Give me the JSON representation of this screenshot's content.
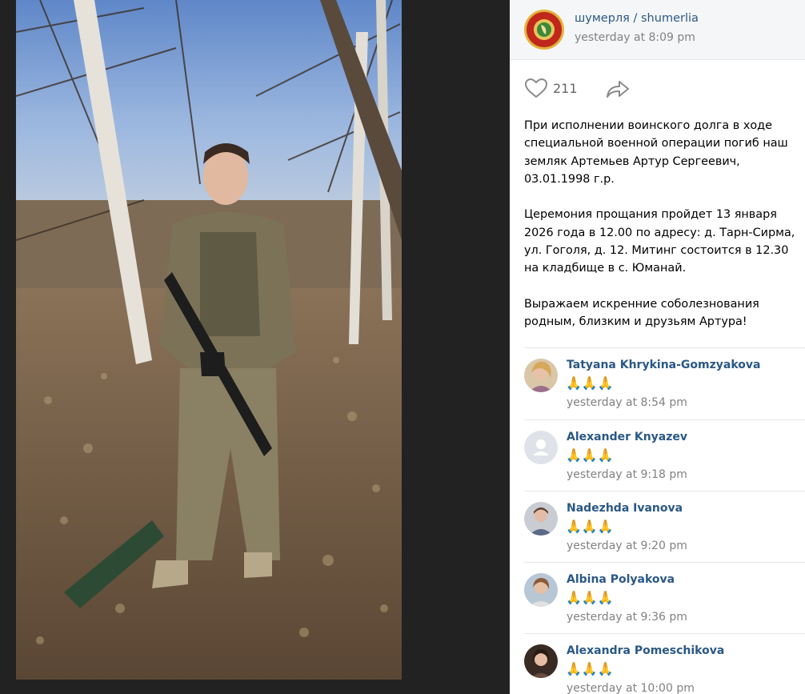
{
  "post": {
    "author": "шумерля / shumerlia",
    "time": "yesterday at 8:09 pm",
    "likes": "211",
    "paragraphs": [
      "При исполнении воинского долга в ходе специальной военной операции погиб наш земляк Артемьев Артур Сергеевич, 03.01.1998 г.р.",
      "Церемония прощания пройдет 13 января 2026 года в 12.00 по адресу: д. Тарн-Сирма, ул. Гоголя, д. 12. Митинг состоится в 12.30 на кладбище в с. Юманай.",
      "Выражаем искренние соболезнования родным, близким и друзьям Артура!"
    ]
  },
  "icons": {
    "like": "heart-icon",
    "share": "share-arrow-icon"
  },
  "comments": [
    {
      "author": "Tatyana Khrykina-Gomzyakova",
      "text": "🙏🙏🙏",
      "time": "yesterday at 8:54 pm",
      "avatar": "photo"
    },
    {
      "author": "Alexander Knyazev",
      "text": "🙏🙏🙏",
      "time": "yesterday at 9:18 pm",
      "avatar": "placeholder"
    },
    {
      "author": "Nadezhda Ivanova",
      "text": "🙏🙏🙏",
      "time": "yesterday at 9:20 pm",
      "avatar": "photo"
    },
    {
      "author": "Albina Polyakova",
      "text": "🙏🙏🙏",
      "time": "yesterday at 9:36 pm",
      "avatar": "photo"
    },
    {
      "author": "Alexandra Pomeschikova",
      "text": "🙏🙏🙏",
      "time": "yesterday at 10:00 pm",
      "avatar": "photo"
    }
  ],
  "colors": {
    "link": "#2a5885",
    "muted": "#828282",
    "viewer_bg": "#222222",
    "header_bg": "#f5f6f8"
  }
}
